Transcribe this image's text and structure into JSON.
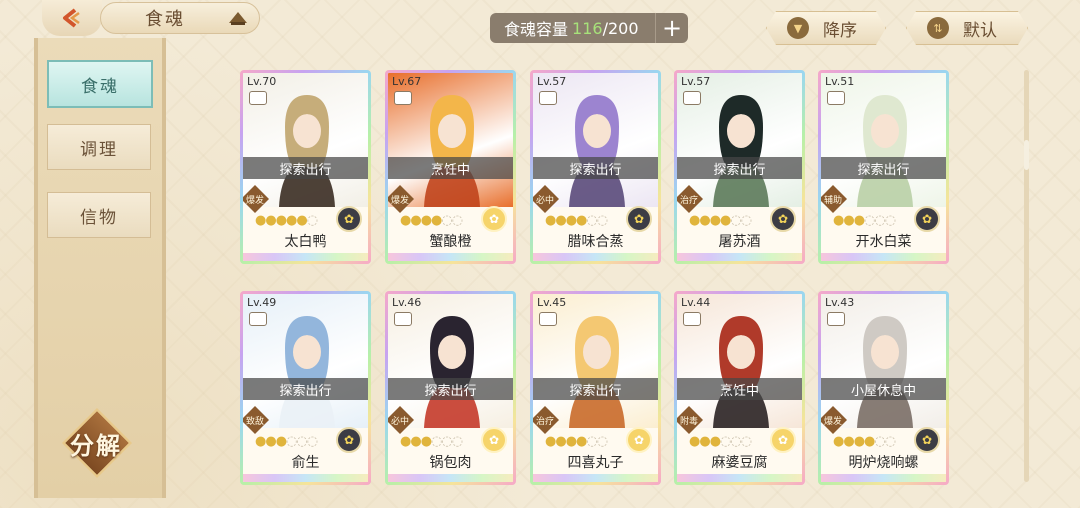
{
  "header": {
    "title": "食魂",
    "capacity_label": "食魂容量",
    "capacity_current": "116",
    "capacity_max": "/200",
    "add_label": "+",
    "sort_desc_label": "降序",
    "sort_default_label": "默认"
  },
  "sidebar": {
    "items": [
      {
        "label": "食魂",
        "active": true
      },
      {
        "label": "调理",
        "active": false
      },
      {
        "label": "信物",
        "active": false
      }
    ],
    "decompose_label": "分解"
  },
  "cards": [
    {
      "level": "Lv.70",
      "status": "探索出行",
      "role": "爆发",
      "stars": 5,
      "element": "dark",
      "name": "太白鸭",
      "palette": [
        "#f2efe6",
        "#c6ad7a",
        "#3a2c22"
      ]
    },
    {
      "level": "Lv.67",
      "status": "烹饪中",
      "role": "爆发",
      "stars": 4,
      "element": "gold",
      "name": "蟹酿橙",
      "palette": [
        "#e86f2c",
        "#f3b64a",
        "#c0441c"
      ]
    },
    {
      "level": "Lv.57",
      "status": "探索出行",
      "role": "必中",
      "stars": 4,
      "element": "dark",
      "name": "腊味合蒸",
      "palette": [
        "#ece6f3",
        "#9c84d0",
        "#5a4a7a"
      ]
    },
    {
      "level": "Lv.57",
      "status": "探索出行",
      "role": "治疗",
      "stars": 4,
      "element": "dark",
      "name": "屠苏酒",
      "palette": [
        "#e4efe4",
        "#1e2a28",
        "#5c7a5a"
      ]
    },
    {
      "level": "Lv.51",
      "status": "探索出行",
      "role": "辅助",
      "stars": 3,
      "element": "dark",
      "name": "开水白菜",
      "palette": [
        "#eef5e8",
        "#dfe8d0",
        "#b9cfa6"
      ]
    },
    {
      "level": "Lv.49",
      "status": "探索出行",
      "role": "致敌",
      "stars": 3,
      "element": "dark",
      "name": "俞生",
      "palette": [
        "#e6f0f8",
        "#93b6dc",
        "#eaf1f6"
      ]
    },
    {
      "level": "Lv.46",
      "status": "探索出行",
      "role": "必中",
      "stars": 3,
      "element": "gold",
      "name": "锅包肉",
      "palette": [
        "#f6efe2",
        "#2a2430",
        "#c43a2a"
      ]
    },
    {
      "level": "Lv.45",
      "status": "探索出行",
      "role": "治疗",
      "stars": 4,
      "element": "gold",
      "name": "四喜丸子",
      "palette": [
        "#fbeed0",
        "#f4c872",
        "#c96a2a"
      ]
    },
    {
      "level": "Lv.44",
      "status": "烹饪中",
      "role": "附毒",
      "stars": 3,
      "element": "gold",
      "name": "麻婆豆腐",
      "palette": [
        "#f6e6d8",
        "#b03a2a",
        "#2a2224"
      ]
    },
    {
      "level": "Lv.43",
      "status": "小屋休息中",
      "role": "爆发",
      "stars": 4,
      "element": "dark",
      "name": "明炉烧响螺",
      "palette": [
        "#f2eee8",
        "#cfcac4",
        "#7a6e66"
      ]
    }
  ]
}
